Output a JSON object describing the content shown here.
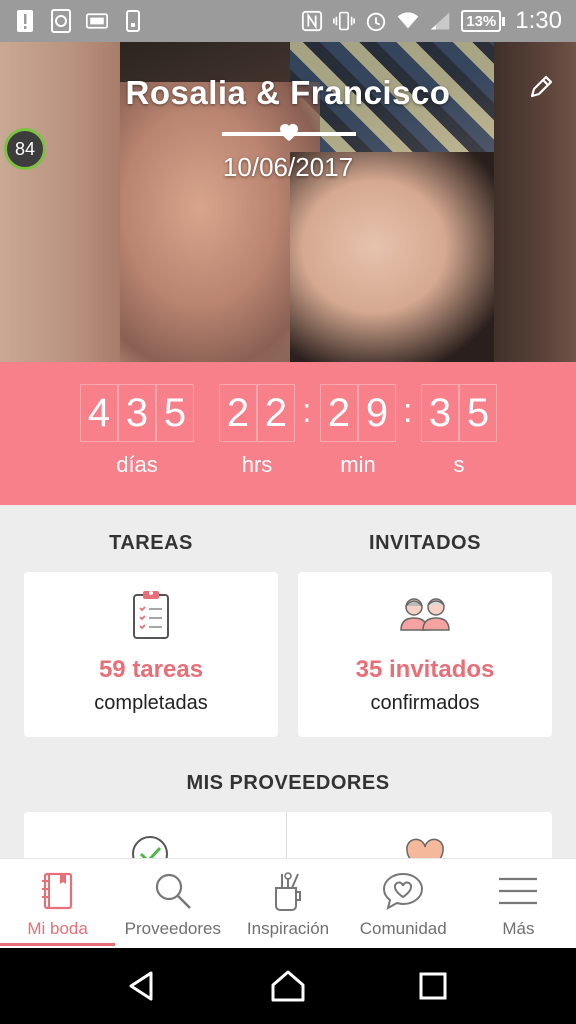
{
  "status_bar": {
    "battery": "13%",
    "time": "1:30"
  },
  "hero": {
    "couple_names": "Rosalia & Francisco",
    "date": "10/06/2017",
    "score": "84"
  },
  "countdown": {
    "days": [
      "4",
      "3",
      "5"
    ],
    "hours": [
      "2",
      "2"
    ],
    "minutes": [
      "2",
      "9"
    ],
    "seconds": [
      "3",
      "5"
    ],
    "labels": {
      "days": "días",
      "hours": "hrs",
      "minutes": "min",
      "seconds": "s"
    }
  },
  "tareas": {
    "title": "TAREAS",
    "value": "59 tareas",
    "sub": "completadas"
  },
  "invitados": {
    "title": "INVITADOS",
    "value": "35 invitados",
    "sub": "confirmados"
  },
  "proveedores": {
    "title": "MIS PROVEEDORES"
  },
  "tabs": [
    {
      "label": "Mi boda",
      "icon": "notebook-icon",
      "active": true
    },
    {
      "label": "Proveedores",
      "icon": "search-icon",
      "active": false
    },
    {
      "label": "Inspiración",
      "icon": "brush-cup-icon",
      "active": false
    },
    {
      "label": "Comunidad",
      "icon": "chat-heart-icon",
      "active": false
    },
    {
      "label": "Más",
      "icon": "menu-icon",
      "active": false
    }
  ],
  "colors": {
    "accent": "#e86f78",
    "countdown_bg": "#f8808a",
    "status_bar": "#9b9b9b"
  }
}
